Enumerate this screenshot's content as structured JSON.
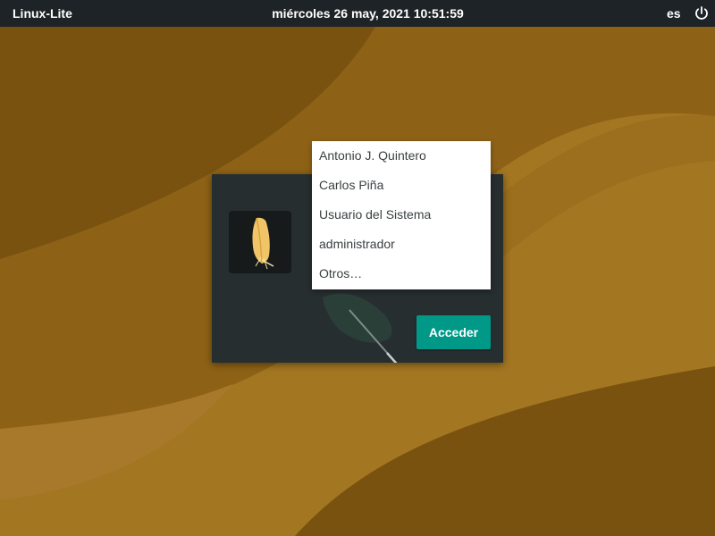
{
  "top_panel": {
    "brand": "Linux-Lite",
    "datetime": "miércoles 26 may, 2021 10:51:59",
    "language": "es",
    "power_icon": "power-icon"
  },
  "login": {
    "avatar_icon": "linux-lite-feather-icon",
    "login_button": "Acceder",
    "accent_color": "#009988"
  },
  "user_menu": {
    "items": [
      {
        "label": "Antonio J. Quintero"
      },
      {
        "label": "Carlos Piña"
      },
      {
        "label": "Usuario del Sistema"
      },
      {
        "label": "administrador"
      },
      {
        "label": "Otros…"
      }
    ]
  },
  "colors": {
    "panel": "#1d2326",
    "dialog": "#272e30",
    "wallpaper": "#a07420"
  }
}
